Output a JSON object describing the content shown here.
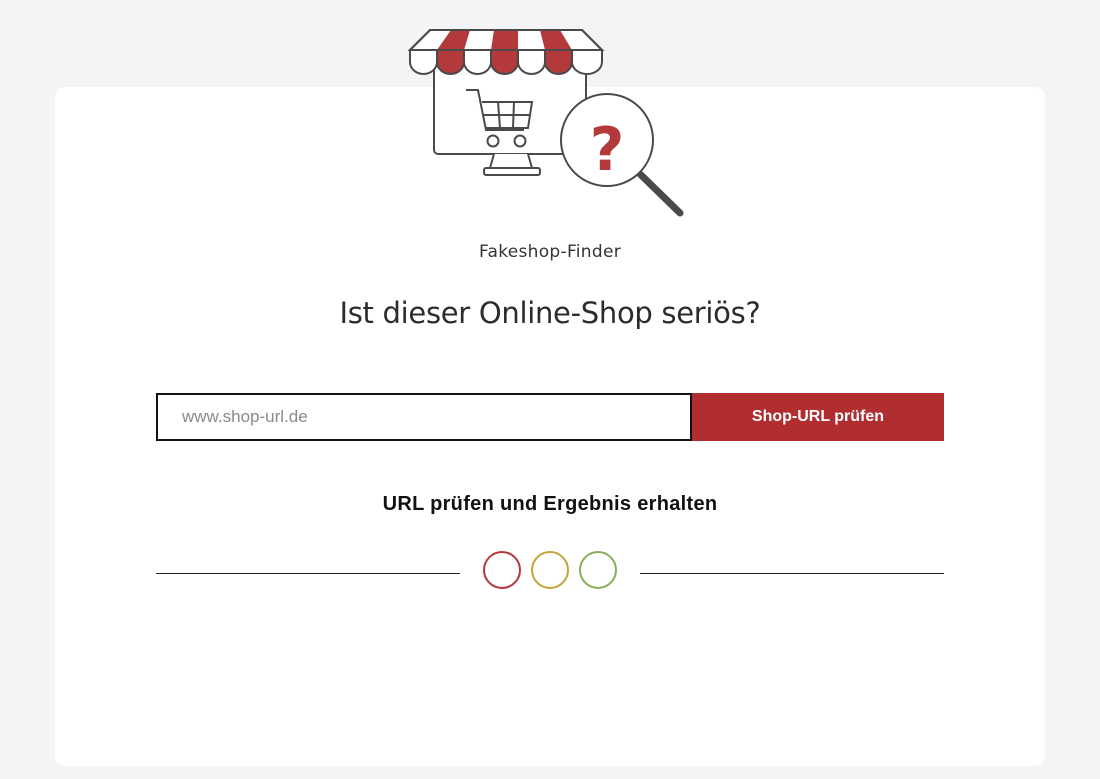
{
  "app": {
    "brand_name": "Fakeshop-Finder"
  },
  "hero": {
    "title": "Ist dieser Online-Shop seriös?",
    "illustration_icon": "shop-magnifier-question-icon",
    "question_mark": "?"
  },
  "search": {
    "placeholder": "www.shop-url.de",
    "value": "",
    "button_label": "Shop-URL prüfen"
  },
  "result": {
    "heading": "URL prüfen und Ergebnis erhalten",
    "indicators": [
      {
        "name": "red",
        "color": "#b3393b"
      },
      {
        "name": "yellow",
        "color": "#c6a43a"
      },
      {
        "name": "green",
        "color": "#8aad5a"
      }
    ]
  },
  "colors": {
    "accent": "#b02e30",
    "background": "#f4f4f6",
    "card": "#ffffff"
  }
}
